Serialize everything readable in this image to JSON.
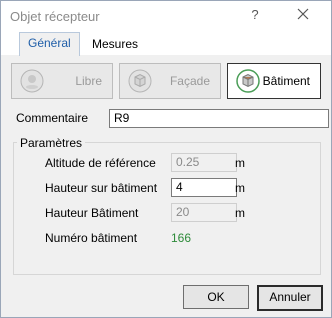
{
  "window": {
    "title": "Objet récepteur",
    "help_label": "?",
    "close_icon": "close-icon"
  },
  "tabs": [
    {
      "label": "Général",
      "active": true
    },
    {
      "label": "Mesures",
      "active": false
    }
  ],
  "types": {
    "libre": {
      "label": "Libre",
      "icon": "ground-point-icon",
      "active": false
    },
    "facade": {
      "label": "Façade",
      "icon": "facade-cube-icon",
      "active": false
    },
    "batiment": {
      "label": "Bâtiment",
      "icon": "building-cube-icon",
      "active": true
    }
  },
  "comment": {
    "label": "Commentaire",
    "value": "R9"
  },
  "params": {
    "title": "Paramètres",
    "altitude": {
      "label": "Altitude de référence",
      "value": "0.25",
      "unit": "m"
    },
    "hauteur_sur": {
      "label": "Hauteur sur bâtiment",
      "value": "4",
      "unit": "m"
    },
    "hauteur_bat": {
      "label": "Hauteur Bâtiment",
      "value": "20",
      "unit": "m"
    },
    "numero": {
      "label": "Numéro bâtiment",
      "value": "166"
    }
  },
  "buttons": {
    "ok": "OK",
    "cancel": "Annuler"
  },
  "colors": {
    "accent_tab": "#1f5ea8",
    "numero_value": "#2e8b3a"
  }
}
